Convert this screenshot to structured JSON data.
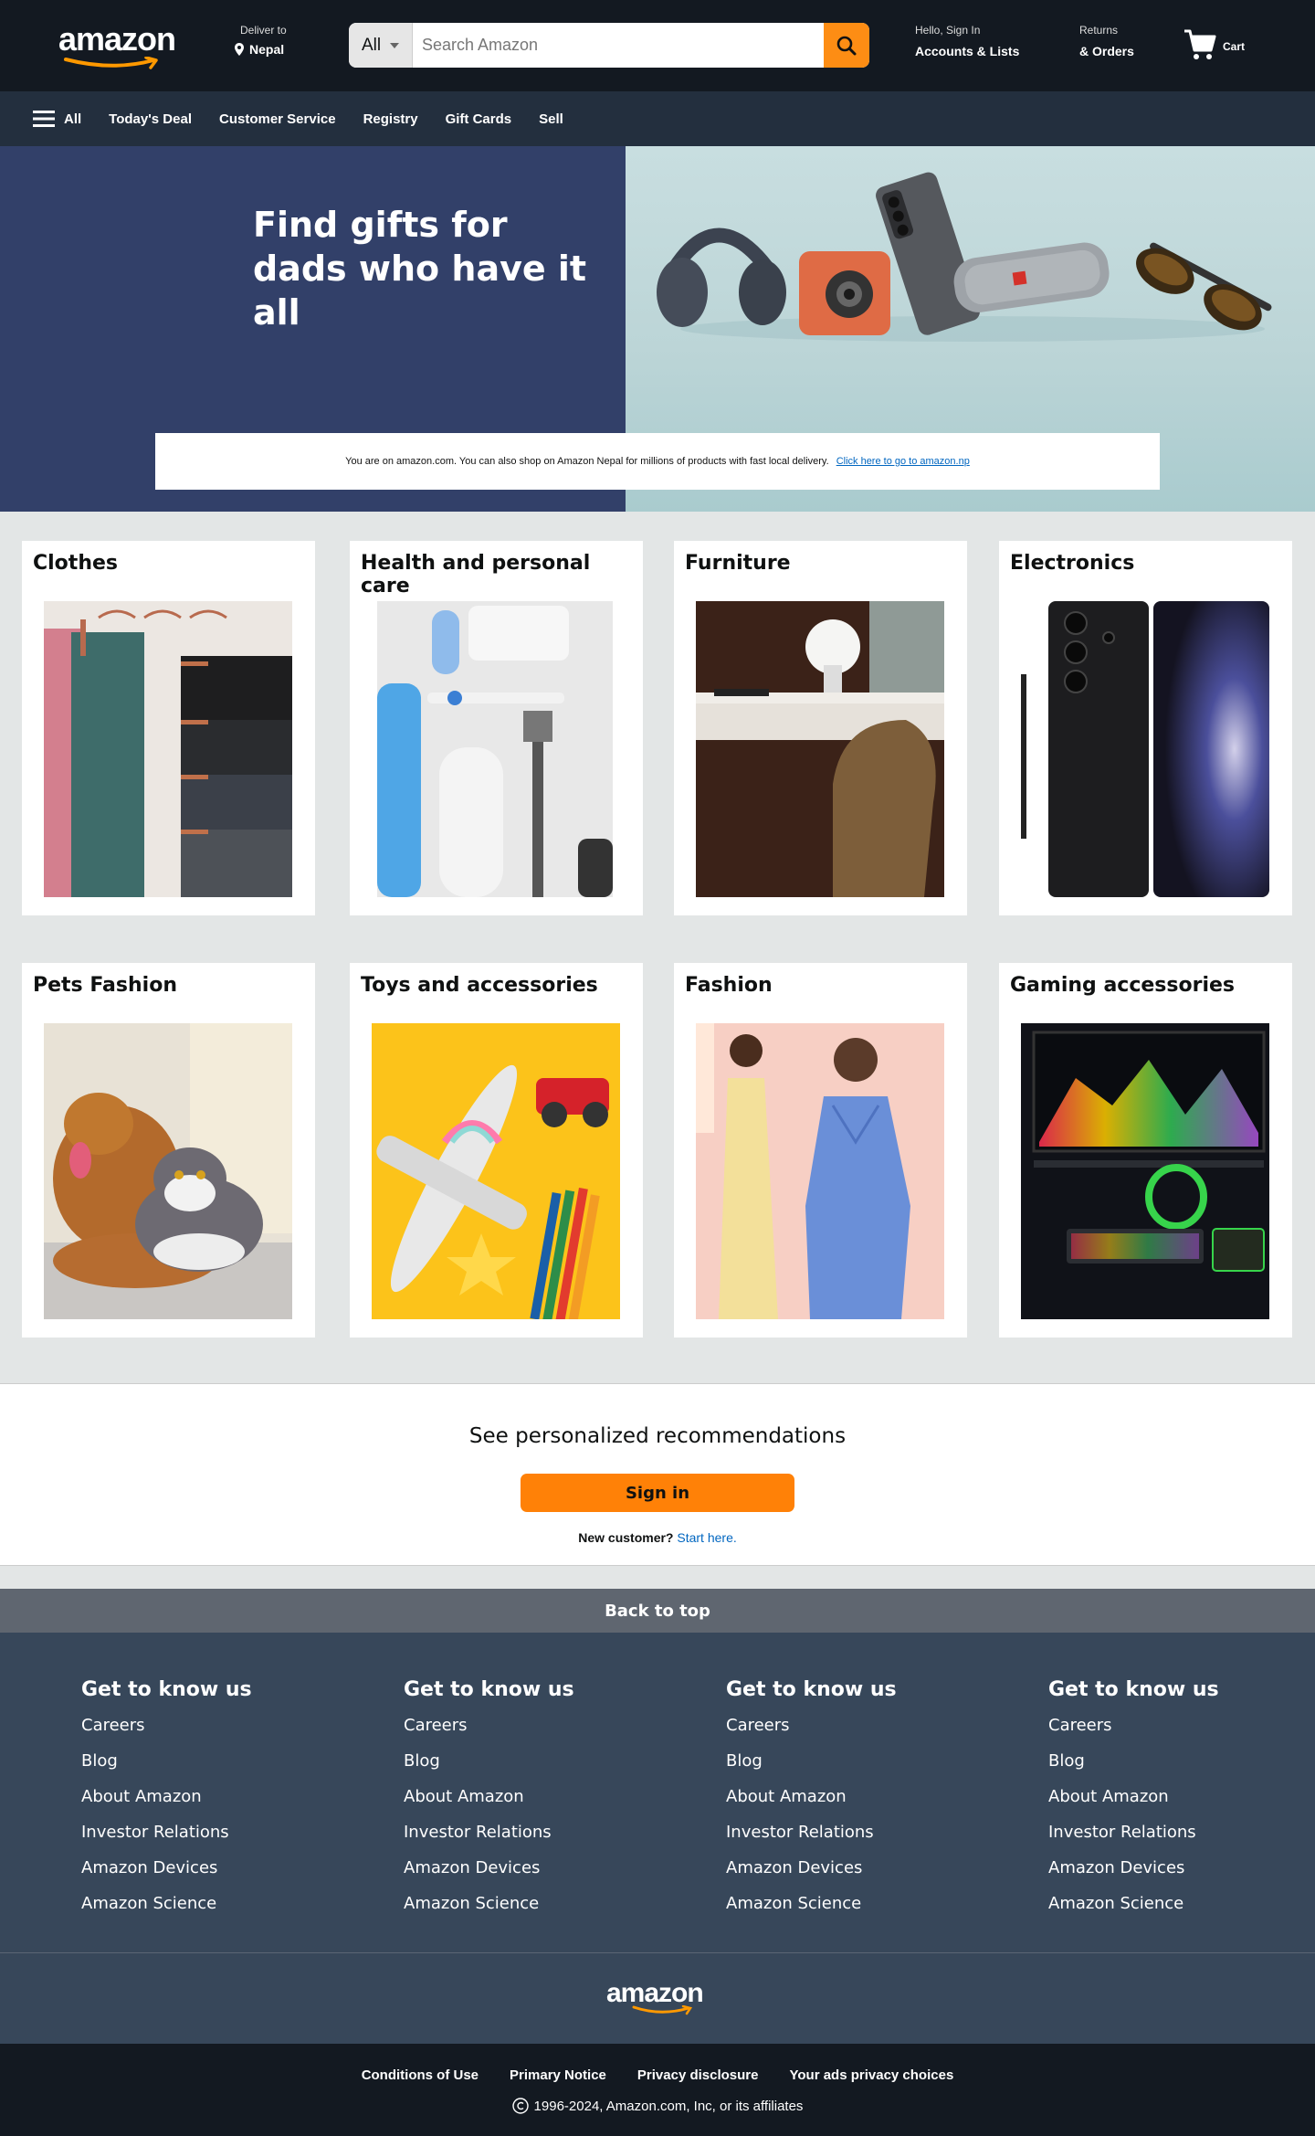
{
  "header": {
    "logo": "amazon",
    "deliver_to": "Deliver to",
    "location": "Nepal",
    "search_category": "All",
    "search_placeholder": "Search Amazon",
    "account_greeting": "Hello, Sign In",
    "account_label": "Accounts & Lists",
    "returns_l1": "Returns",
    "returns_l2": "& Orders",
    "cart_label": "Cart"
  },
  "nav": {
    "all": "All",
    "items": [
      "Today's Deal",
      "Customer Service",
      "Registry",
      "Gift Cards",
      "Sell"
    ]
  },
  "hero": {
    "headline_1": "Find gifts for",
    "headline_2": "dads who have it all",
    "notice_text": "You are on  amazon.com. You can also shop on Amazon Nepal for millions  of products with fast local delivery.",
    "notice_link": "Click here to go to amazon.np"
  },
  "categories": [
    {
      "title": "Clothes"
    },
    {
      "title": "Health and personal care"
    },
    {
      "title": "Furniture"
    },
    {
      "title": "Electronics"
    },
    {
      "title": "Pets Fashion"
    },
    {
      "title": "Toys and accessories"
    },
    {
      "title": "Fashion"
    },
    {
      "title": "Gaming accessories"
    }
  ],
  "signin": {
    "message": "See personalized recommendations",
    "button": "Sign in",
    "new_customer": "New customer?",
    "start_here": "Start here."
  },
  "footer": {
    "back_to_top": "Back to top",
    "columns": [
      {
        "heading": "Get to know us",
        "links": [
          "Careers",
          "Blog",
          "About Amazon",
          "Investor Relations",
          "Amazon Devices",
          "Amazon Science"
        ]
      },
      {
        "heading": "Get to know us",
        "links": [
          "Careers",
          "Blog",
          "About Amazon",
          "Investor Relations",
          "Amazon Devices",
          "Amazon Science"
        ]
      },
      {
        "heading": "Get to know us",
        "links": [
          "Careers",
          "Blog",
          "About Amazon",
          "Investor Relations",
          "Amazon Devices",
          "Amazon Science"
        ]
      },
      {
        "heading": "Get to know us",
        "links": [
          "Careers",
          "Blog",
          "About Amazon",
          "Investor Relations",
          "Amazon Devices",
          "Amazon Science"
        ]
      }
    ],
    "logo": "amazon",
    "legal_links": [
      "Conditions of Use",
      "Primary Notice",
      "Privacy disclosure",
      "Your ads privacy choices"
    ],
    "copyright": "1996-2024, Amazon.com, Inc, or its affiliates"
  },
  "colors": {
    "header_bg": "#131921",
    "nav_bg": "#232f3e",
    "search_button": "#fd8d14",
    "signin_button": "#ff8107",
    "hero_left": "#324069",
    "footer_bg": "#37475a",
    "link_blue": "#0066c0"
  }
}
